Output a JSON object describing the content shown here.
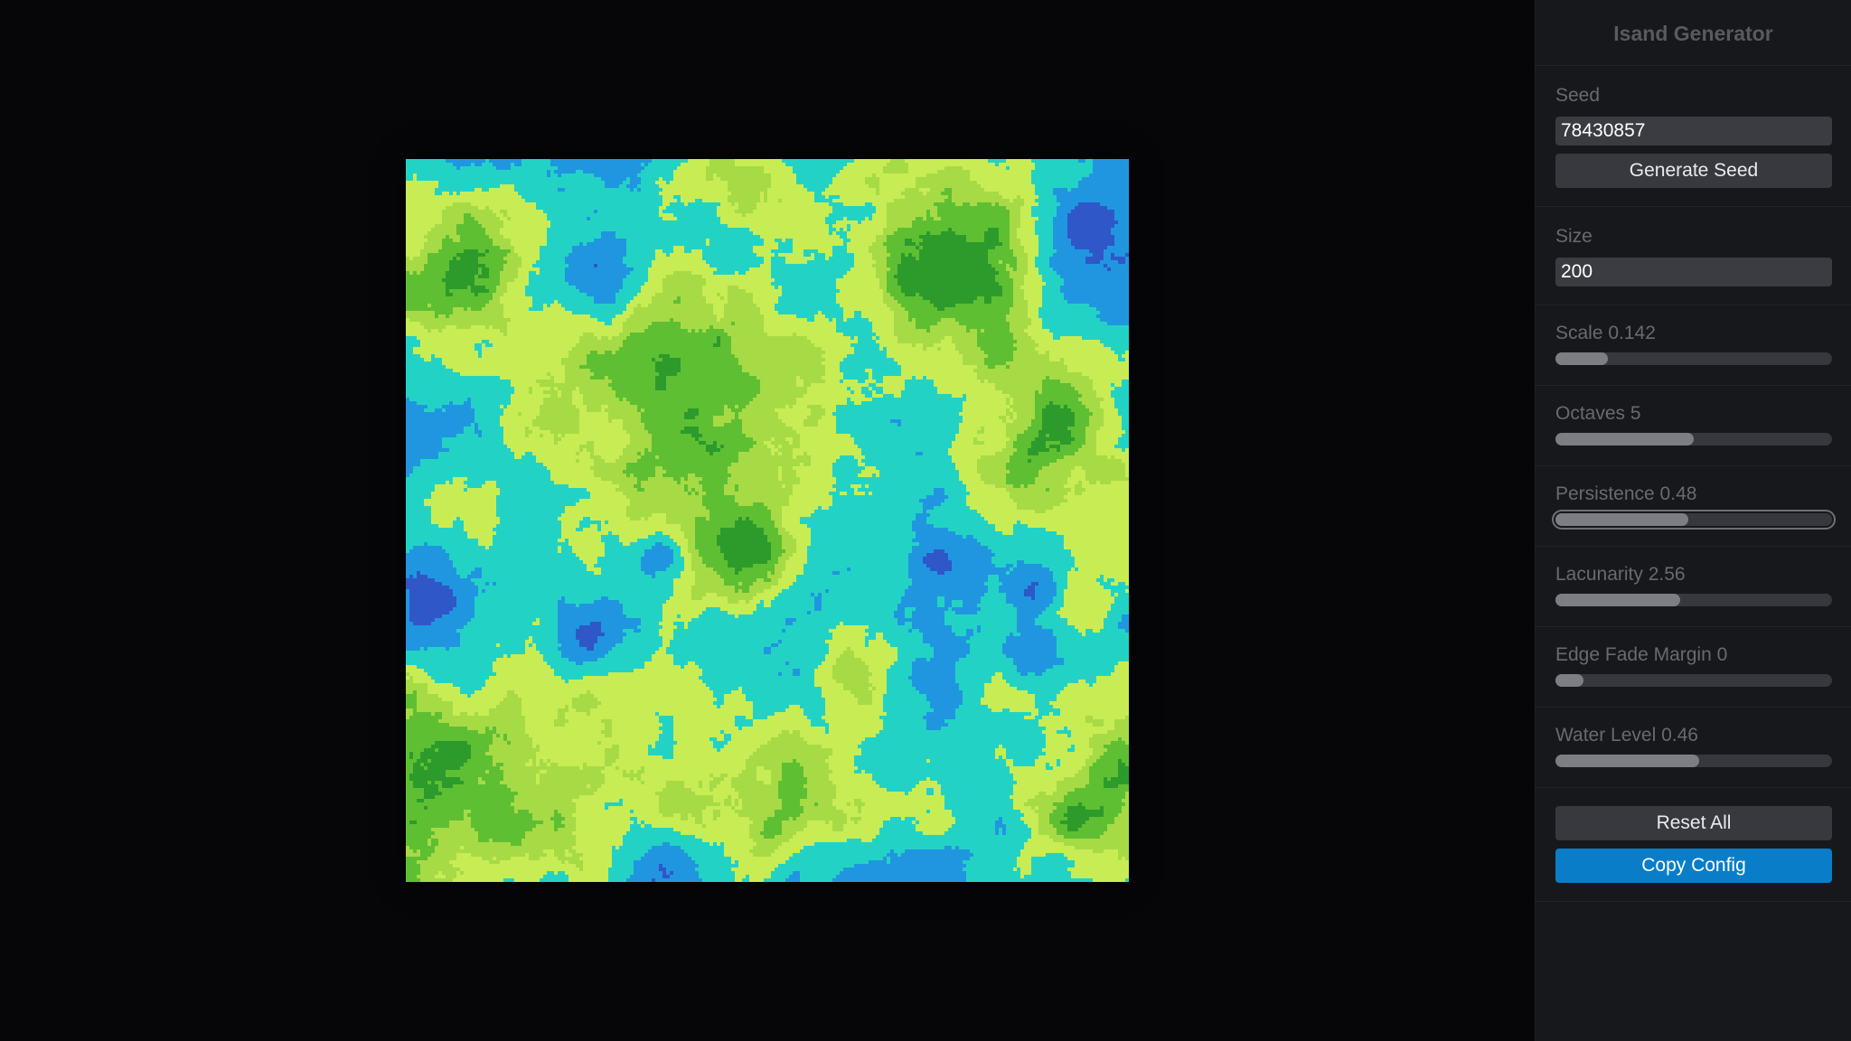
{
  "panel": {
    "title": "Isand Generator"
  },
  "seed": {
    "label": "Seed",
    "value": "78430857",
    "button_label": "Generate Seed"
  },
  "size": {
    "label": "Size",
    "value": "200"
  },
  "sliders": [
    {
      "id": "scale",
      "label": "Scale 0.142",
      "fraction": 0.19
    },
    {
      "id": "octaves",
      "label": "Octaves 5",
      "fraction": 0.5
    },
    {
      "id": "persistence",
      "label": "Persistence 0.48",
      "fraction": 0.48,
      "focused": true
    },
    {
      "id": "lacunarity",
      "label": "Lacunarity 2.56",
      "fraction": 0.45
    },
    {
      "id": "edge-fade-margin",
      "label": "Edge Fade Margin 0",
      "fraction": 0.1
    },
    {
      "id": "water-level",
      "label": "Water Level 0.46",
      "fraction": 0.52
    }
  ],
  "actions": {
    "reset_label": "Reset All",
    "copy_label": "Copy Config"
  },
  "colors": {
    "deep_water": "#2f57c8",
    "water": "#2196e0",
    "shallow": "#22d3c5",
    "sand": "#c8ec54",
    "grass_light": "#a6db46",
    "grass": "#5fbf33",
    "forest": "#2c9b2c",
    "accent": "#0a7dc9"
  }
}
